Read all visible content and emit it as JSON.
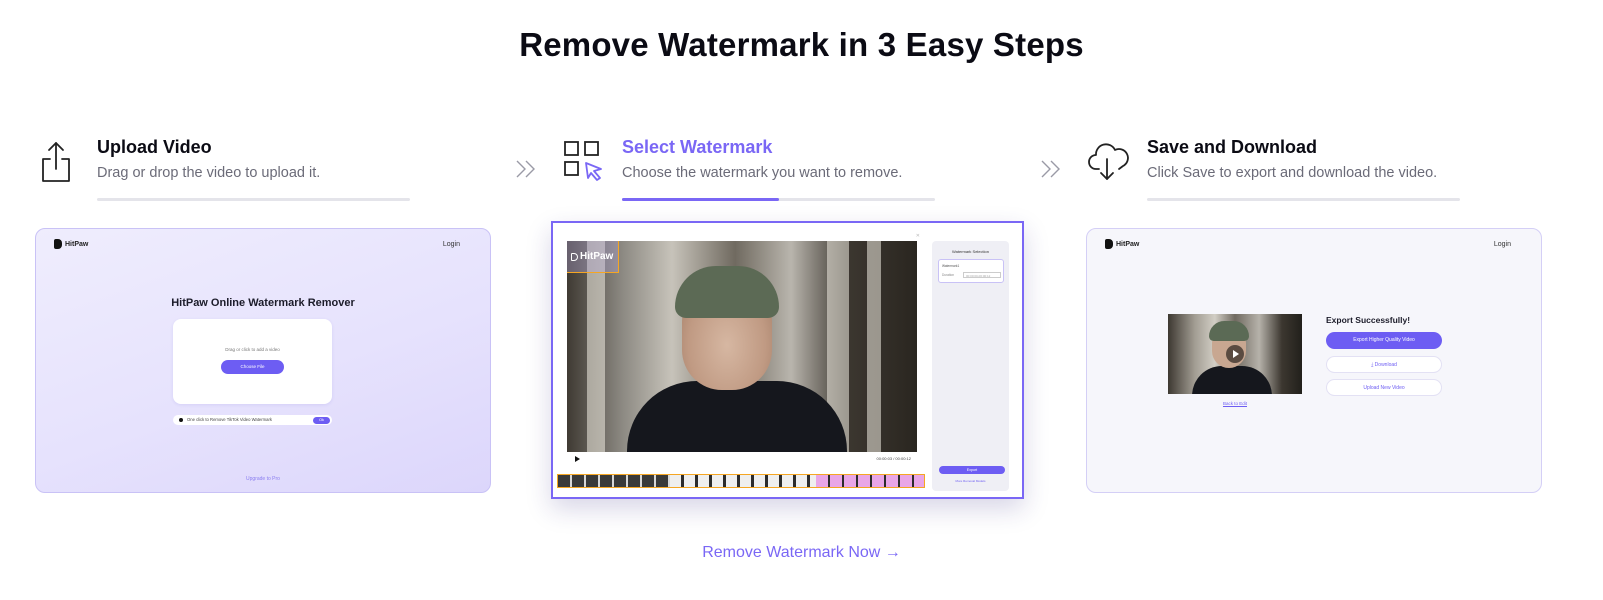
{
  "page": {
    "title": "Remove Watermark in 3 Easy Steps"
  },
  "steps": [
    {
      "title": "Upload Video",
      "description": "Drag or drop the video to upload it.",
      "icon": "upload-icon",
      "progress": 0
    },
    {
      "title": "Select Watermark",
      "description": "Choose the watermark you want to remove.",
      "icon": "select-grid-cursor-icon",
      "progress": 0.5
    },
    {
      "title": "Save and Download",
      "description": "Click Save to export and download the video.",
      "icon": "cloud-download-icon",
      "progress": 0
    }
  ],
  "upload_card": {
    "brand": "HitPaw",
    "login": "Login",
    "heading": "HitPaw Online Watermark Remover",
    "drop_hint": "Drag or click to add a video",
    "choose_button": "Choose File",
    "tiktok_placeholder": "One click to Remove TikTok Video Watermark",
    "tiktok_ok": "Ok",
    "footer_link": "Upgrade to Pro"
  },
  "editor_card": {
    "watermark_label": "HitPaw",
    "panel_title": "Watermark Selection",
    "field_label": "Watermark1",
    "duration_label": "Duration",
    "duration_value": "00:00:00-00:00:12",
    "time_display": "00:00:03 / 00:00:12",
    "export_button": "Export",
    "more_link": "More Removal Models"
  },
  "download_card": {
    "brand": "HitPaw",
    "login": "Login",
    "export_title": "Export Successfully!",
    "export_hq_button": "Export Higher Quality Video",
    "download_button": "Download",
    "upload_new_button": "Upload New Video",
    "back_link": "Back to Edit"
  },
  "cta": {
    "label": "Remove Watermark Now →"
  },
  "colors": {
    "accent": "#7a67f5",
    "button": "#6d5df3",
    "text": "#0b0b14",
    "muted": "#6b6b78"
  }
}
